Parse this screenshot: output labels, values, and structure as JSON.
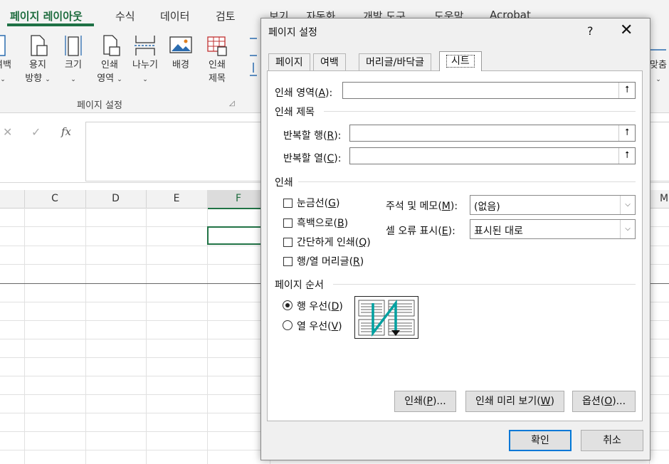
{
  "ribbon": {
    "tabs": [
      "페이지 레이아웃",
      "수식",
      "데이터",
      "검토",
      "보기",
      "자동화",
      "개발 도구",
      "도움말",
      "Acrobat"
    ],
    "buttons": {
      "margins": "여백",
      "orientation": "용지",
      "orientation2": "방향",
      "size": "크기",
      "print_area": "인쇄",
      "print_area2": "영역",
      "breaks": "나누기",
      "background": "배경",
      "print_titles": "인쇄",
      "print_titles2": "제목",
      "fit_partial": "맞춤"
    },
    "group_label": "페이지 설정",
    "chevron": "⌄"
  },
  "formula_bar": {
    "cancel": "✕",
    "enter": "✓",
    "fx": "fx"
  },
  "columns": [
    "C",
    "D",
    "E",
    "F",
    "M"
  ],
  "dialog": {
    "title": "페이지 설정",
    "help": "?",
    "close": "✕",
    "tabs": [
      "페이지",
      "여백",
      "머리글/바닥글",
      "시트"
    ],
    "active_tab": "시트",
    "print_area": {
      "label": "인쇄 영역",
      "key": "A",
      "value": ""
    },
    "print_titles": {
      "section": "인쇄 제목",
      "rows_label": "반복할 행",
      "rows_key": "R",
      "rows_value": "",
      "cols_label": "반복할 열",
      "cols_key": "C",
      "cols_value": ""
    },
    "print": {
      "section": "인쇄",
      "gridlines": {
        "label": "눈금선",
        "key": "G",
        "checked": false
      },
      "black_white": {
        "label": "흑백으로",
        "key": "B",
        "checked": false
      },
      "draft": {
        "label": "간단하게 인쇄",
        "key": "Q",
        "checked": false
      },
      "headings": {
        "label": "행/열 머리글",
        "key": "R",
        "checked": false
      },
      "comments_label": "주석 및 메모",
      "comments_key": "M",
      "comments_value": "(없음)",
      "errors_label": "셀 오류 표시",
      "errors_key": "E",
      "errors_value": "표시된 대로"
    },
    "page_order": {
      "section": "페이지 순서",
      "down_then_over": {
        "label": "행 우선",
        "key": "D",
        "selected": true
      },
      "over_then_down": {
        "label": "열 우선",
        "key": "V",
        "selected": false
      }
    },
    "buttons": {
      "print": "인쇄",
      "print_key": "P",
      "preview": "인쇄 미리 보기",
      "preview_key": "W",
      "options": "옵션",
      "options_key": "O",
      "ok": "확인",
      "cancel": "취소"
    },
    "collapse_glyph": "⭡",
    "dropdown_glyph": "⌵",
    "colors": {
      "accent": "#217346",
      "preview_arrow": "#00a0a0",
      "default_button": "#0078d7"
    }
  }
}
